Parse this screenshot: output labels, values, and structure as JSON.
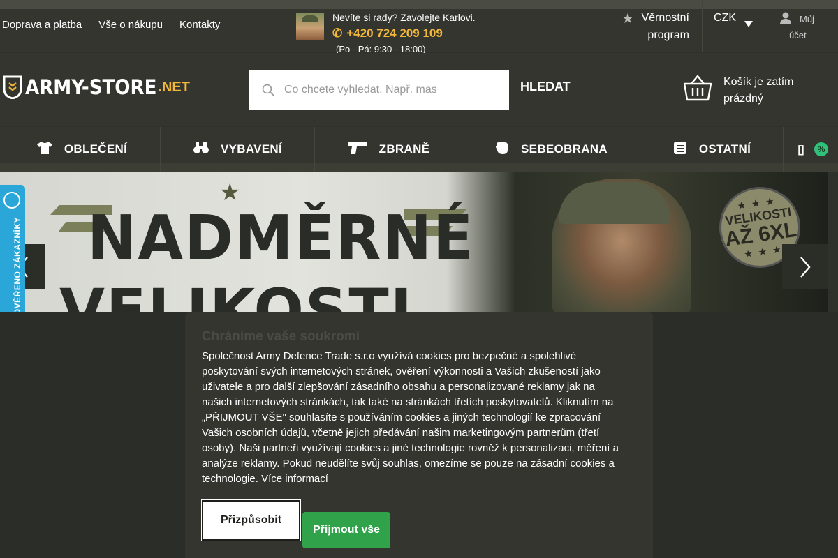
{
  "topbar": {
    "links": [
      "Doprava a platba",
      "Vše o nákupu",
      "Kontakty"
    ],
    "help_text": "Nevíte si rady? Zavolejte Karlovi.",
    "phone": "+420 724 209 109",
    "hours": "(Po - Pá: 9:30 - 18:00)",
    "loyalty_line1": "Věrnostní",
    "loyalty_line2": "program",
    "currency": "CZK",
    "account_line1": "Můj",
    "account_line2": "účet"
  },
  "header": {
    "logo_main": "ARMY-STORE",
    "logo_suffix": ".NET",
    "search_placeholder": "Co chcete vyhledat. Např. mas",
    "search_button": "HLEDAT",
    "cart_text": "Košík je zatím prázdný"
  },
  "nav": {
    "items": [
      {
        "label": "OBLEČENÍ",
        "icon": "tshirt-icon"
      },
      {
        "label": "VYBAVENÍ",
        "icon": "binoculars-icon"
      },
      {
        "label": "ZBRANĚ",
        "icon": "pistol-icon"
      },
      {
        "label": "SEBEOBRANA",
        "icon": "fist-icon"
      },
      {
        "label": "OSTATNÍ",
        "icon": "list-icon"
      }
    ],
    "sale_icon_text": "%"
  },
  "hero": {
    "title_line1": "NADMĚRNÉ",
    "title_line2": "VELIKOSTI",
    "badge_line1": "VELIKOSTI",
    "badge_line2": "AŽ 6XL"
  },
  "verified_widget": {
    "label": "OVĚŘENO ZÁKAZNÍKY"
  },
  "cookie": {
    "title": "Chráníme vaše soukromí",
    "body": "Společnost Army Defence Trade s.r.o využívá cookies pro bezpečné a spolehlivé poskytování svých internetových stránek, ověření výkonnosti a Vašich zkušeností jako uživatele a pro další zlepšování zásadního obsahu a personalizované reklamy jak na našich internetových stránkách, tak také na stránkách třetích poskytovatelů. Kliknutím na „PŘIJMOUT VŠE\" souhlasíte s používáním cookies a jiných technologií ke zpracování Vašich osobních údajů, včetně jejich předávání našim marketingovým partnerům (třetí osoby). Naši partneři využívají cookies a jiné technologie rovněž k personalizaci, měření a analýze reklamy. Pokud neudělíte svůj souhlas, omezíme se pouze na zásadní cookies a technologie.",
    "more_link": "Více informací",
    "customize_button": "Přizpůsobit",
    "accept_button": "Přijmout vše"
  },
  "colors": {
    "accent": "#f3b83a",
    "dark_bg": "#33352e",
    "accept_green": "#2fa24a",
    "verified_blue": "#2aa7d8"
  }
}
